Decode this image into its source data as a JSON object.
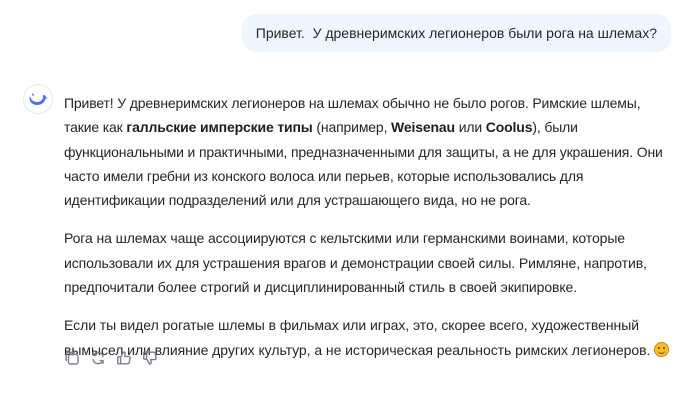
{
  "user_message": "Привет.  У древнеримских легионеров были рога на шлемах?",
  "assistant": {
    "avatar_icon": "whale-logo-icon",
    "paragraph1": {
      "t1": "Привет! У древнеримских легионеров на шлемах обычно не было рогов. Римские шлемы, такие как ",
      "b1": "галльские имперские типы",
      "t2": " (например, ",
      "b2": "Weisenau",
      "t3": " или ",
      "b3": "Coolus",
      "t4": "), были функциональными и практичными, предназначенными для защиты, а не для украшения. Они часто имели гребни из конского волоса или перьев, которые использовались для идентификации подразделений или для устрашающего вида, но не рога."
    },
    "paragraph2": "Рога на шлемах чаще ассоциируются с кельтскими или германскими воинами, которые использовали их для устрашения врагов и демонстрации своей силы. Римляне, напротив, предпочитали более строгий и дисциплинированный стиль в своей экипировке.",
    "paragraph3": "Если ты видел рогатые шлемы в фильмах или играх, это, скорее всего, художественный вымысел или влияние других культур, а не историческая реальность римских легионеров.",
    "emoji": "smiling-face-emoji"
  },
  "actions": [
    "copy-icon",
    "regenerate-icon",
    "thumbs-up-icon",
    "thumbs-down-icon"
  ],
  "colors": {
    "user_bubble": "#eff6ff",
    "text": "#262626",
    "accent": "#4d6bfe",
    "icon": "#7a7f88"
  }
}
